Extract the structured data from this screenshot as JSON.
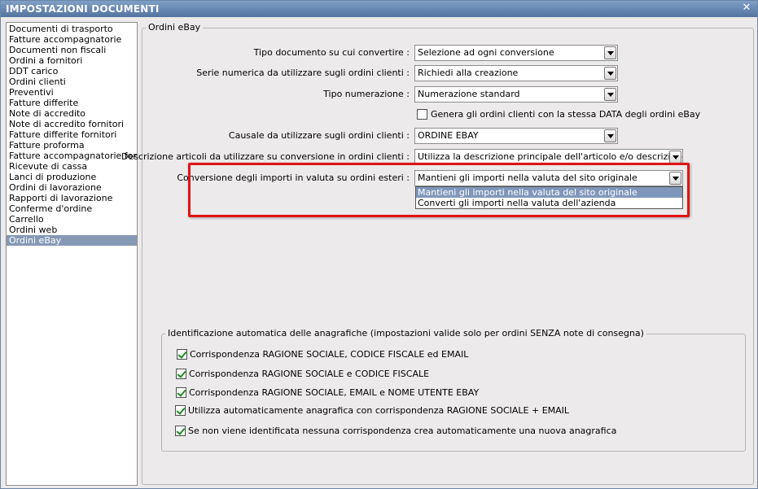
{
  "window": {
    "title": "IMPOSTAZIONI DOCUMENTI",
    "close_glyph": "✕"
  },
  "doclist": {
    "items": [
      "Documenti di trasporto",
      "Fatture accompagnatorie",
      "Documenti non fiscali",
      "Ordini a fornitori",
      "DDT carico",
      "Ordini clienti",
      "Preventivi",
      "Fatture differite",
      "Note di accredito",
      "Note di accredito fornitori",
      "Fatture differite fornitori",
      "Fatture proforma",
      "Fatture accompagnatorie fornitori",
      "Ricevute di cassa",
      "Lanci di produzione",
      "Ordini di lavorazione",
      "Rapporti di lavorazione",
      "Conferme d'ordine",
      "Carrello",
      "Ordini web",
      "Ordini eBay"
    ],
    "selected": "Ordini eBay"
  },
  "ebay_group": {
    "label": "Ordini eBay",
    "tipo_documento": {
      "label": "Tipo documento su cui convertire :",
      "value": "Selezione ad ogni conversione"
    },
    "serie_numerica": {
      "label": "Serie numerica da utilizzare sugli ordini clienti :",
      "value": "Richiedi alla creazione"
    },
    "tipo_numerazione": {
      "label": "Tipo numerazione :",
      "value": "Numerazione standard"
    },
    "stessa_data": {
      "label": "Genera gli ordini clienti con la stessa DATA degli ordini eBay",
      "checked": false
    },
    "causale": {
      "label": "Causale da utilizzare sugli ordini clienti :",
      "value": "ORDINE EBAY"
    },
    "descrizione_articoli": {
      "label": "Descrizione articoli da utilizzare su conversione in ordini clienti :",
      "value": "Utilizza la descrizione principale dell'articolo e/o descrizione docu"
    },
    "conversione_valuta": {
      "label": "Conversione degli importi in valuta su ordini esteri :",
      "value": "Mantieni gli importi nella valuta del sito originale",
      "options": [
        "Mantieni gli importi nella valuta del sito originale",
        "Converti gli importi nella valuta dell'azienda"
      ]
    }
  },
  "ident_group": {
    "label": "Identificazione automatica delle anagrafiche (impostazioni valide solo per ordini SENZA note di consegna)",
    "options": [
      {
        "label": "Corrispondenza RAGIONE SOCIALE, CODICE FISCALE ed EMAIL",
        "checked": true
      },
      {
        "label": "Corrispondenza RAGIONE SOCIALE e CODICE FISCALE",
        "checked": true
      },
      {
        "label": "Corrispondenza RAGIONE SOCIALE, EMAIL e NOME UTENTE EBAY",
        "checked": true
      },
      {
        "label": "Utilizza automaticamente anagrafica con corrispondenza RAGIONE SOCIALE + EMAIL",
        "checked": true
      },
      {
        "label": "Se non viene identificata nessuna corrispondenza crea automaticamente una nuova anagrafica",
        "checked": true
      }
    ]
  }
}
